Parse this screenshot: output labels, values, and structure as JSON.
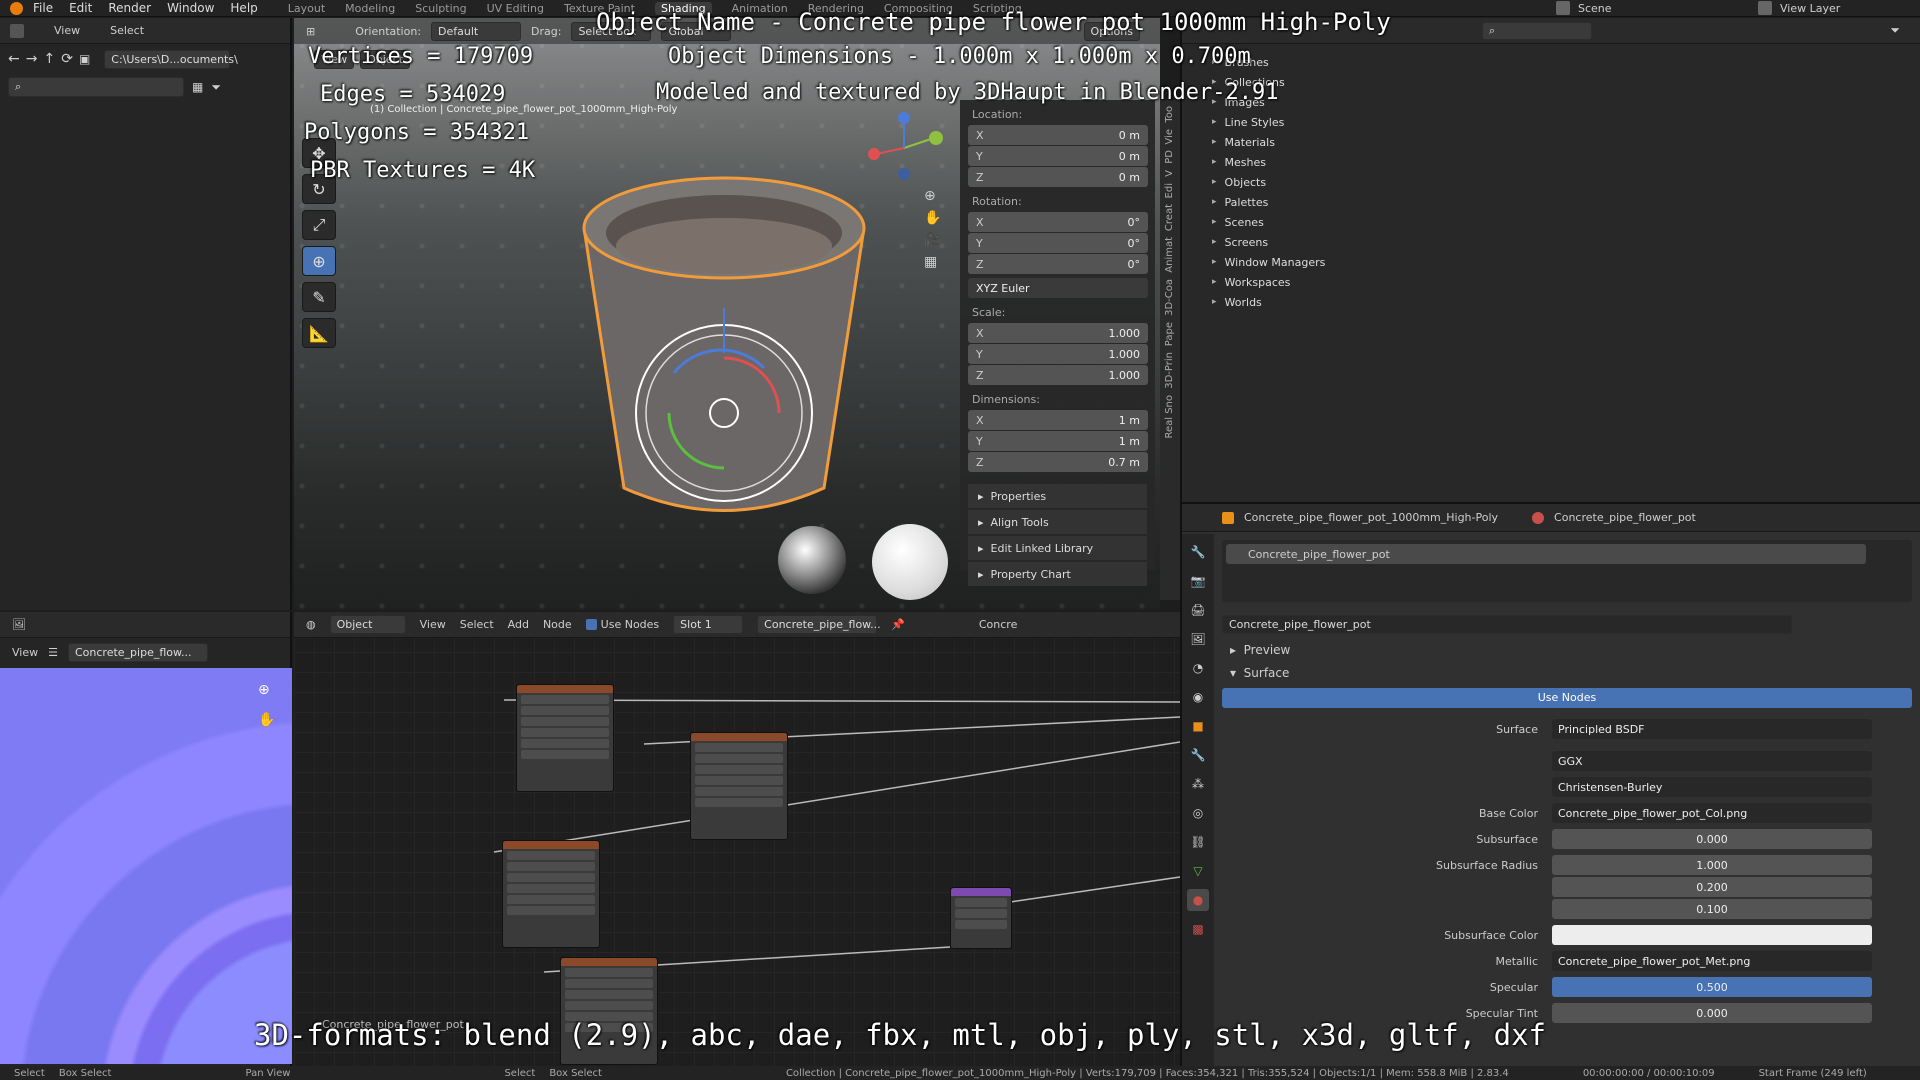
{
  "topbar": {
    "menus": [
      "File",
      "Edit",
      "Render",
      "Window",
      "Help"
    ],
    "workspaces": [
      "Layout",
      "Modeling",
      "Sculpting",
      "UV Editing",
      "Texture Paint",
      "Shading",
      "Animation",
      "Rendering",
      "Compositing",
      "Scripting"
    ],
    "active_workspace": "Shading",
    "scene": "Scene",
    "view_layer": "View Layer"
  },
  "filebrowser": {
    "menus": [
      "View",
      "Select"
    ],
    "path": "C:\\Users\\D...ocuments\\"
  },
  "viewport": {
    "header": {
      "orientation_label": "Orientation:",
      "orientation": "Default",
      "drag_label": "Drag:",
      "drag": "Select Box",
      "transform": "Global",
      "options": "Options",
      "mode": "Object",
      "view": "View"
    },
    "collection_label": "(1) Collection | Concrete_pipe_flower_pot_1000mm_High-Poly",
    "npanel": {
      "location_label": "Location:",
      "location": [
        {
          "axis": "X",
          "value": "0 m"
        },
        {
          "axis": "Y",
          "value": "0 m"
        },
        {
          "axis": "Z",
          "value": "0 m"
        }
      ],
      "rotation_label": "Rotation:",
      "rotation": [
        {
          "axis": "X",
          "value": "0°"
        },
        {
          "axis": "Y",
          "value": "0°"
        },
        {
          "axis": "Z",
          "value": "0°"
        }
      ],
      "rotation_mode": "XYZ Euler",
      "scale_label": "Scale:",
      "scale": [
        {
          "axis": "X",
          "value": "1.000"
        },
        {
          "axis": "Y",
          "value": "1.000"
        },
        {
          "axis": "Z",
          "value": "1.000"
        }
      ],
      "dimensions_label": "Dimensions:",
      "dimensions": [
        {
          "axis": "X",
          "value": "1 m"
        },
        {
          "axis": "Y",
          "value": "1 m"
        },
        {
          "axis": "Z",
          "value": "0.7 m"
        }
      ],
      "sections": [
        "Properties",
        "Align Tools",
        "Edit Linked Library",
        "Property Chart"
      ]
    },
    "vtabs": [
      "Too",
      "Vie",
      "PD",
      "V",
      "Edi",
      "Creat",
      "Animat",
      "3D-Coa",
      "Pape",
      "3D-Prin",
      "Real Sno"
    ]
  },
  "overlay": {
    "object_name": "Object Name - Concrete pipe flower pot 1000mm High-Poly",
    "dimensions": "Object Dimensions - 1.000m x 1.000m x 0.700m",
    "credit": "Modeled and textured by 3DHaupt in Blender-2.91",
    "vertices": "Vertices = 179709",
    "edges": "Edges = 534029",
    "polygons": "Polygons = 354321",
    "textures": "PBR Textures = 4K",
    "formats": "3D-formats: blend (2.9), abc, dae, fbx, mtl, obj, ply, stl, x3d, gltf, dxf"
  },
  "outliner": {
    "items": [
      "Brushes",
      "Collections",
      "Images",
      "Line Styles",
      "Materials",
      "Meshes",
      "Objects",
      "Palettes",
      "Scenes",
      "Screens",
      "Window Managers",
      "Workspaces",
      "Worlds"
    ]
  },
  "props": {
    "object_name": "Concrete_pipe_flower_pot_1000mm_High-Poly",
    "material_name": "Concrete_pipe_flower_pot",
    "slot_material": "Concrete_pipe_flower_pot",
    "datablock": "Concrete_pipe_flower_pot",
    "preview": "Preview",
    "surface_section": "Surface",
    "use_nodes": "Use Nodes",
    "rows": [
      {
        "label": "Surface",
        "value": "Principled BSDF",
        "num": false
      },
      {
        "label": "",
        "value": "GGX",
        "num": false
      },
      {
        "label": "",
        "value": "Christensen-Burley",
        "num": false
      },
      {
        "label": "Base Color",
        "value": "Concrete_pipe_flower_pot_Col.png",
        "num": false
      },
      {
        "label": "Subsurface",
        "value": "0.000",
        "num": true
      },
      {
        "label": "Subsurface Radius",
        "value": "1.000",
        "num": true
      },
      {
        "label": "",
        "value": "0.200",
        "num": true
      },
      {
        "label": "",
        "value": "0.100",
        "num": true
      },
      {
        "label": "Subsurface Color",
        "value": "",
        "num": false
      },
      {
        "label": "Metallic",
        "value": "Concrete_pipe_flower_pot_Met.png",
        "num": false
      },
      {
        "label": "Specular",
        "value": "0.500",
        "num": true
      },
      {
        "label": "Specular Tint",
        "value": "0.000",
        "num": true
      }
    ]
  },
  "nodeeditor": {
    "header": {
      "mode": "Object",
      "view": "View",
      "select": "Select",
      "add": "Add",
      "node": "Node",
      "use_nodes": "Use Nodes",
      "slot": "Slot 1",
      "material": "Concrete_pipe_flow...",
      "material2": "Concre"
    },
    "footer_label": "Concrete_pipe_flower_pot"
  },
  "imgeditor": {
    "view": "View",
    "image": "Concrete_pipe_flow..."
  },
  "status": {
    "left": [
      "Select",
      "Box Select",
      "Pan View",
      "Select",
      "Box Select"
    ],
    "info": "Collection | Concrete_pipe_flower_pot_1000mm_High-Poly | Verts:179,709 | Faces:354,321 | Tris:355,524 | Objects:1/1 | Mem: 558.8 MiB | 2.83.4",
    "time": "00:00:00:00 / 00:00:10:09",
    "start": "Start Frame (249 left)"
  }
}
